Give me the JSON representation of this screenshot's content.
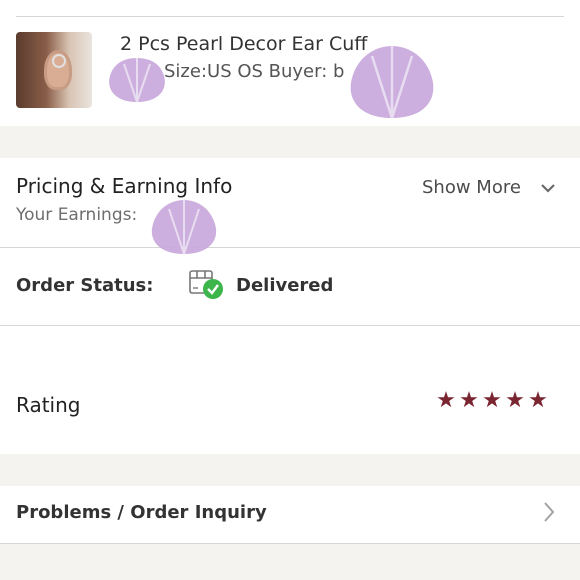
{
  "item": {
    "title": "2 Pcs Pearl Decor Ear Cuff",
    "meta": "Size:US OS  Buyer: b"
  },
  "pricing": {
    "title": "Pricing & Earning Info",
    "earnings_label": "Your Earnings:",
    "show_more": "Show More"
  },
  "order_status": {
    "label": "Order Status:",
    "value": "Delivered"
  },
  "rating": {
    "label": "Rating",
    "stars": 5,
    "star_color": "#7a2631"
  },
  "problems": {
    "label": "Problems / Order Inquiry"
  },
  "colors": {
    "background": "#f4f3f0",
    "card": "#ffffff",
    "delivered_check": "#3cb54a",
    "shell_sticker": "#c9a8dc"
  },
  "icons": [
    "chevron-down-icon",
    "package-delivered-icon",
    "star-icon",
    "chevron-right-icon",
    "shell-sticker"
  ]
}
